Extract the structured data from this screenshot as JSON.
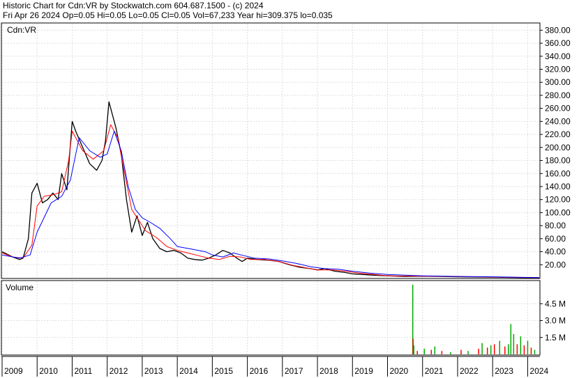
{
  "header": {
    "line1": "Historic Chart for Cdn:VR by Stockwatch.com 604.687.1500 - (c) 2024",
    "line2": "Fri Apr 26 2024   Op=0.05  Hi=0.05  Lo=0.05  Cl=0.05  Vol=67,233  Year hi=309.375  lo=0.035"
  },
  "chart_data": [
    {
      "type": "line",
      "title": "Cdn:VR",
      "ylim": [
        0,
        390
      ],
      "yticks": [
        20,
        40,
        60,
        80,
        100,
        120,
        140,
        160,
        180,
        200,
        220,
        240,
        260,
        280,
        300,
        320,
        340,
        360,
        380
      ],
      "ytick_labels": [
        "20.00",
        "40.00",
        "60.00",
        "80.00",
        "100.00",
        "120.00",
        "140.00",
        "160.00",
        "180.00",
        "200.00",
        "220.00",
        "240.00",
        "260.00",
        "280.00",
        "300.00",
        "320.00",
        "340.00",
        "360.00",
        "380.00"
      ],
      "xlim": [
        2009.0,
        2024.33
      ],
      "grid": true,
      "series": [
        {
          "role": "price",
          "color": "#000000",
          "x": [
            2009.0,
            2009.3,
            2009.5,
            2009.6,
            2009.75,
            2009.85,
            2010.0,
            2010.15,
            2010.3,
            2010.45,
            2010.6,
            2010.7,
            2010.85,
            2011.0,
            2011.1,
            2011.3,
            2011.5,
            2011.7,
            2011.85,
            2011.95,
            2012.05,
            2012.15,
            2012.25,
            2012.4,
            2012.55,
            2012.7,
            2012.85,
            2013.0,
            2013.15,
            2013.3,
            2013.5,
            2013.7,
            2013.9,
            2014.1,
            2014.3,
            2014.5,
            2014.7,
            2014.9,
            2015.1,
            2015.3,
            2015.5,
            2015.7,
            2015.85,
            2016.0,
            2016.3,
            2016.6,
            2016.9,
            2017.2,
            2017.5,
            2017.8,
            2018.0,
            2018.2,
            2018.5,
            2018.8,
            2019.0,
            2019.3,
            2019.6,
            2020.0,
            2020.5,
            2021.0,
            2021.5,
            2022.0,
            2022.5,
            2023.0,
            2023.5,
            2024.0,
            2024.33
          ],
          "y": [
            40,
            32,
            28,
            30,
            60,
            130,
            145,
            115,
            120,
            130,
            120,
            160,
            135,
            240,
            225,
            200,
            175,
            165,
            180,
            210,
            270,
            250,
            230,
            190,
            120,
            70,
            95,
            65,
            85,
            60,
            45,
            40,
            42,
            38,
            30,
            28,
            27,
            30,
            35,
            42,
            38,
            30,
            25,
            30,
            28,
            27,
            25,
            20,
            16,
            14,
            12,
            14,
            10,
            8,
            6,
            5,
            4,
            3,
            2,
            2.5,
            2,
            1.5,
            1.2,
            1,
            0.5,
            0.1,
            0.05
          ]
        },
        {
          "role": "moving-average",
          "color": "#ff0000",
          "x": [
            2009.0,
            2009.3,
            2009.6,
            2009.85,
            2010.0,
            2010.2,
            2010.5,
            2010.7,
            2010.9,
            2011.0,
            2011.3,
            2011.6,
            2011.9,
            2012.1,
            2012.3,
            2012.5,
            2012.7,
            2012.9,
            2013.1,
            2013.4,
            2013.7,
            2014.0,
            2014.3,
            2014.6,
            2014.9,
            2015.2,
            2015.5,
            2015.8,
            2016.1,
            2016.5,
            2016.9,
            2017.3,
            2017.7,
            2018.0,
            2018.4,
            2018.8,
            2019.2,
            2019.6,
            2020.0,
            2021.0,
            2022.0,
            2023.0,
            2024.0,
            2024.33
          ],
          "y": [
            38,
            32,
            30,
            50,
            110,
            125,
            128,
            132,
            180,
            225,
            195,
            182,
            195,
            235,
            215,
            160,
            105,
            88,
            72,
            62,
            48,
            42,
            38,
            34,
            30,
            28,
            33,
            32,
            28,
            28,
            25,
            19,
            15,
            12,
            12,
            10,
            7,
            5,
            3,
            2.5,
            1.8,
            1.2,
            0.3,
            0.1
          ]
        },
        {
          "role": "moving-average",
          "color": "#0000ff",
          "x": [
            2009.0,
            2009.5,
            2009.8,
            2010.0,
            2010.4,
            2010.7,
            2010.95,
            2011.2,
            2011.5,
            2011.8,
            2012.0,
            2012.2,
            2012.4,
            2012.6,
            2012.8,
            2013.0,
            2013.2,
            2013.5,
            2013.8,
            2014.0,
            2014.4,
            2014.8,
            2015.0,
            2015.3,
            2015.6,
            2015.9,
            2016.2,
            2016.6,
            2017.0,
            2017.4,
            2017.8,
            2018.2,
            2018.6,
            2019.0,
            2019.5,
            2020.0,
            2021.0,
            2022.0,
            2023.0,
            2024.0,
            2024.33
          ],
          "y": [
            35,
            30,
            35,
            70,
            115,
            125,
            150,
            215,
            195,
            185,
            190,
            225,
            195,
            140,
            105,
            92,
            86,
            76,
            60,
            48,
            44,
            40,
            35,
            32,
            38,
            34,
            30,
            29,
            26,
            22,
            17,
            14,
            13,
            10,
            7,
            5,
            3,
            2,
            1.5,
            0.5,
            0.2
          ]
        }
      ]
    },
    {
      "type": "bar",
      "title": "Volume",
      "ylim": [
        0,
        6.5
      ],
      "yticks": [
        1.5,
        3.0,
        4.5
      ],
      "ytick_labels": [
        "1.5 M",
        "3.0 M",
        "4.5 M"
      ],
      "grid": true,
      "x": [
        2020.72,
        2020.73,
        2020.75,
        2020.85,
        2021.05,
        2021.25,
        2021.35,
        2021.55,
        2021.8,
        2022.1,
        2022.3,
        2022.6,
        2022.7,
        2022.85,
        2022.95,
        2023.05,
        2023.2,
        2023.35,
        2023.45,
        2023.52,
        2023.6,
        2023.7,
        2023.8,
        2023.9,
        2024.0,
        2024.1,
        2024.2
      ],
      "values": [
        6.2,
        1.4,
        0.8,
        0.3,
        0.5,
        0.4,
        0.7,
        0.3,
        0.2,
        0.4,
        0.3,
        0.5,
        1.0,
        0.6,
        0.8,
        0.9,
        1.2,
        0.7,
        0.9,
        2.7,
        1.8,
        0.9,
        1.6,
        0.8,
        1.2,
        0.6,
        0.4
      ],
      "colors": [
        "#00aa00",
        "#ff0000",
        "#00aa00",
        "#ff0000",
        "#00aa00",
        "#ff0000",
        "#00aa00",
        "#ff0000",
        "#00aa00",
        "#ff0000",
        "#00aa00",
        "#ff0000",
        "#00aa00",
        "#ff0000",
        "#00aa00",
        "#ff0000",
        "#00aa00",
        "#ff0000",
        "#00aa00",
        "#00aa00",
        "#00aa00",
        "#ff0000",
        "#00aa00",
        "#ff0000",
        "#00aa00",
        "#ff0000",
        "#00aa00"
      ]
    }
  ],
  "x_axis": {
    "years": [
      2009,
      2010,
      2011,
      2012,
      2013,
      2014,
      2015,
      2016,
      2017,
      2018,
      2019,
      2020,
      2021,
      2022,
      2023,
      2024
    ],
    "labels": [
      "2009",
      "2010",
      "2011",
      "2012",
      "2013",
      "2014",
      "2015",
      "2016",
      "2017",
      "2018",
      "2019",
      "2020",
      "2021",
      "2022",
      "2023",
      "2024"
    ]
  }
}
